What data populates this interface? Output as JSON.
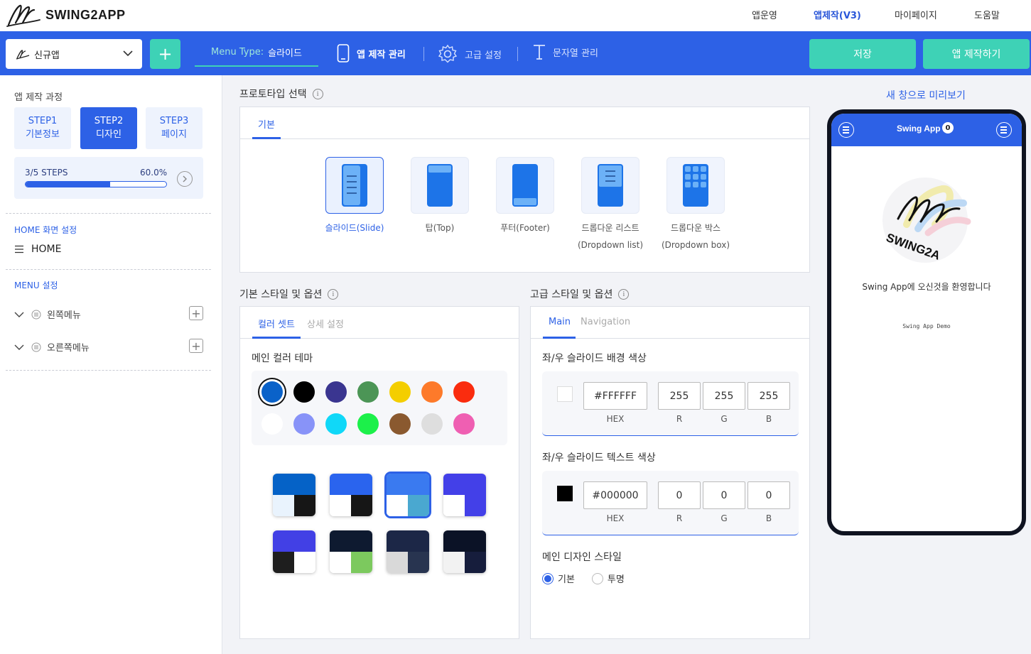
{
  "brand": {
    "name": "SWING2APP"
  },
  "topnav": [
    "앱운영",
    "앱제작(V3)",
    "마이페이지",
    "도움말"
  ],
  "toolbar": {
    "app_name": "신규앱",
    "add_label": "+",
    "menu_type_label": "Menu Type:",
    "menu_type_value": "슬라이드",
    "app_manage": "앱 제작 관리",
    "advanced": "고급 설정",
    "strings": "문자열 관리",
    "save": "저장",
    "make": "앱 제작하기"
  },
  "sidebar": {
    "title": "앱 제작 과정",
    "steps": [
      {
        "line1": "STEP1",
        "line2": "기본정보"
      },
      {
        "line1": "STEP2",
        "line2": "디자인"
      },
      {
        "line1": "STEP3",
        "line2": "페이지"
      }
    ],
    "progress_label": "3/5 STEPS",
    "progress_pct": "60.0%",
    "progress_value": 0.6,
    "home_section": "HOME 화면 설정",
    "home_item": "HOME",
    "menu_section": "MENU 설정",
    "menu_items": [
      "왼쪽메뉴",
      "오른쪽메뉴"
    ]
  },
  "prototype": {
    "title": "프로토타입 선택",
    "tab": "기본",
    "items": [
      {
        "l1": "슬라이드(Slide)",
        "l2": ""
      },
      {
        "l1": "탑(Top)",
        "l2": ""
      },
      {
        "l1": "푸터(Footer)",
        "l2": ""
      },
      {
        "l1": "드롭다운 리스트",
        "l2": "(Dropdown list)"
      },
      {
        "l1": "드롭다운 박스",
        "l2": "(Dropdown box)"
      }
    ]
  },
  "basic_style": {
    "title": "기본 스타일 및 옵션",
    "tabs": [
      "컬러 셋트",
      "상세 설정"
    ],
    "theme_title": "메인 컬러 테마",
    "colors": [
      "#0a62c9",
      "#000000",
      "#3a3590",
      "#4c9556",
      "#f4ce00",
      "#fd7a2a",
      "#fa2c0e",
      "#ffffff",
      "#8893f8",
      "#10d8f8",
      "#1cf04a",
      "#8a592f",
      "#dedede",
      "#ef5fb2"
    ],
    "themes": [
      {
        "top": "#0562c7",
        "bl": "#e9f3fd",
        "br": "#161616"
      },
      {
        "top": "#2a64ee",
        "bl": "#ffffff",
        "br": "#161616"
      },
      {
        "top": "#3a7af0",
        "bl": "#ffffff",
        "br": "#4aa8d0"
      },
      {
        "top": "#4340e8",
        "bl": "#ffffff",
        "br": "#4340e8"
      },
      {
        "top": "#4240e5",
        "bl": "#1e1e1e",
        "br": "#ffffff"
      },
      {
        "top": "#0e1a30",
        "bl": "#ffffff",
        "br": "#7cc95e"
      },
      {
        "top": "#1c2747",
        "bl": "#d9d9d9",
        "br": "#283450"
      },
      {
        "top": "#0b1226",
        "bl": "#f2f2f2",
        "br": "#161d3c"
      }
    ]
  },
  "advanced_style": {
    "title": "고급 스타일 및 옵션",
    "tabs": [
      "Main",
      "Navigation"
    ],
    "bg_title": "좌/우 슬라이드 배경 색상",
    "bg": {
      "hex": "#FFFFFF",
      "r": "255",
      "g": "255",
      "b": "255"
    },
    "text_title": "좌/우 슬라이드 텍스트 색상",
    "text": {
      "hex": "#000000",
      "r": "0",
      "g": "0",
      "b": "0"
    },
    "labels": {
      "hex": "HEX",
      "r": "R",
      "g": "G",
      "b": "B"
    },
    "design_title": "메인 디자인 스타일",
    "radios": [
      "기본",
      "투명"
    ]
  },
  "preview": {
    "link": "새 창으로 미리보기",
    "app_title": "Swing App",
    "badge": "0",
    "welcome": "Swing App에 오신것을 환영합니다",
    "demo": "Swing App Demo"
  }
}
